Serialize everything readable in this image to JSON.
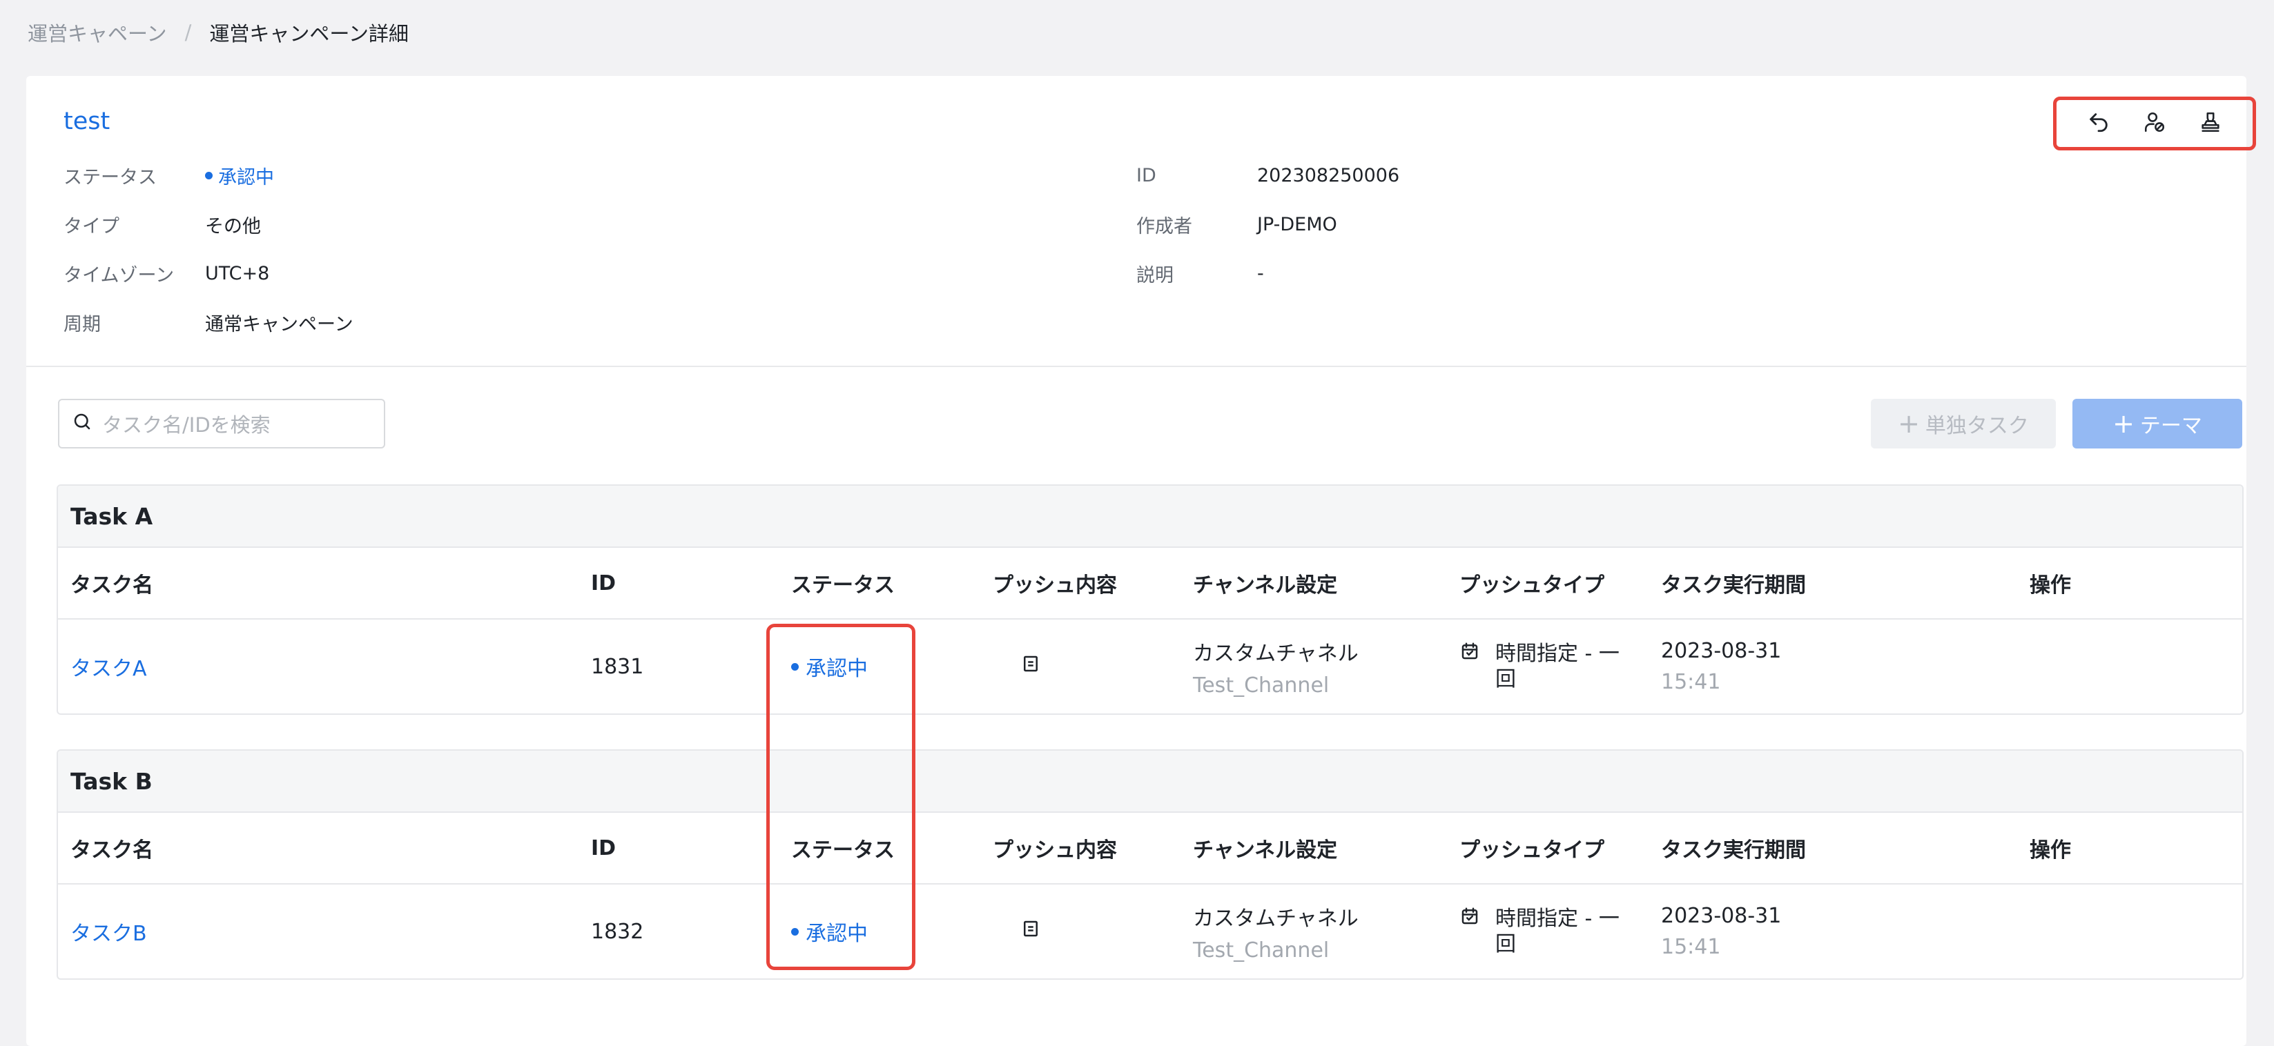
{
  "breadcrumb": {
    "parent": "運営キャペーン",
    "separator": "/",
    "current": "運営キャンペーン詳細"
  },
  "campaign": {
    "title": "test",
    "left_fields": [
      {
        "label": "ステータス",
        "value": "承認中"
      },
      {
        "label": "タイプ",
        "value": "その他"
      },
      {
        "label": "タイムゾーン",
        "value": "UTC+8"
      },
      {
        "label": "周期",
        "value": "通常キャンペーン"
      }
    ],
    "right_fields": [
      {
        "label": "ID",
        "value": "202308250006"
      },
      {
        "label": "作成者",
        "value": "JP-DEMO"
      },
      {
        "label": "説明",
        "value": "-"
      }
    ]
  },
  "actions": {
    "icons": [
      "undo-icon",
      "user-block-icon",
      "stamp-icon"
    ]
  },
  "toolbar": {
    "search_placeholder": "タスク名/IDを検索",
    "single_task_label": "単独タスク",
    "theme_label": "テーマ"
  },
  "columns": [
    "タスク名",
    "ID",
    "ステータス",
    "プッシュ内容",
    "チャンネル設定",
    "プッシュタイプ",
    "タスク実行期間",
    "操作"
  ],
  "tasks": [
    {
      "group": "Task A",
      "row": {
        "name": "タスクA",
        "id": "1831",
        "status": "承認中",
        "channel": "カスタムチャネル",
        "channel_sub": "Test_Channel",
        "push_type": "時間指定 - 一回",
        "period_date": "2023-08-31",
        "period_time": "15:41"
      }
    },
    {
      "group": "Task B",
      "row": {
        "name": "タスクB",
        "id": "1832",
        "status": "承認中",
        "channel": "カスタムチャネル",
        "channel_sub": "Test_Channel",
        "push_type": "時間指定 - 一回",
        "period_date": "2023-08-31",
        "period_time": "15:41"
      }
    }
  ],
  "colors": {
    "accent": "#1a6ee0",
    "highlight": "#e8443b",
    "theme_button": "#94b9f3"
  }
}
